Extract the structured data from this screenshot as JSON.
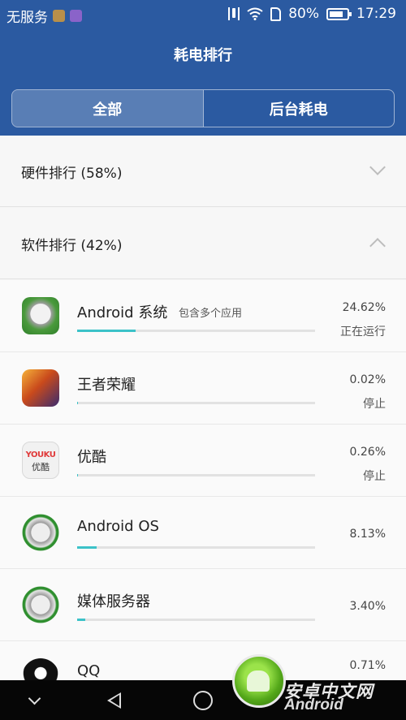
{
  "status_bar": {
    "carrier": "无服务",
    "battery_percent": "80%",
    "battery_level": 0.8,
    "time": "17:29"
  },
  "header": {
    "title": "耗电排行",
    "tabs": [
      {
        "label": "全部",
        "active": true
      },
      {
        "label": "后台耗电",
        "active": false
      }
    ]
  },
  "sections": {
    "hardware": {
      "label": "硬件排行 (58%)",
      "expanded": false
    },
    "software": {
      "label": "软件排行 (42%)",
      "expanded": true
    }
  },
  "apps": [
    {
      "name": "Android 系统",
      "sub": "包含多个应用",
      "percent": "24.62%",
      "state": "正在运行",
      "usage": 0.2462,
      "icon": "android-system-icon"
    },
    {
      "name": "王者荣耀",
      "sub": "",
      "percent": "0.02%",
      "state": "停止",
      "usage": 0.0002,
      "icon": "honor-of-kings-icon"
    },
    {
      "name": "优酷",
      "sub": "",
      "percent": "0.26%",
      "state": "停止",
      "usage": 0.0026,
      "icon": "youku-icon"
    },
    {
      "name": "Android OS",
      "sub": "",
      "percent": "8.13%",
      "state": "",
      "usage": 0.0813,
      "icon": "android-os-icon"
    },
    {
      "name": "媒体服务器",
      "sub": "",
      "percent": "3.40%",
      "state": "",
      "usage": 0.034,
      "icon": "media-server-icon"
    },
    {
      "name": "QQ",
      "sub": "",
      "percent": "0.71%",
      "state": "",
      "usage": 0.0071,
      "icon": "qq-icon"
    }
  ],
  "youku_icon_text": {
    "brand": "YOUKU",
    "label": "优酷"
  },
  "watermark": {
    "text": "安卓中文网",
    "sub": "Android"
  },
  "colors": {
    "header_bg": "#2b5aa1",
    "usage_bar": "#3cc2c8",
    "nav_bg": "#060606"
  }
}
